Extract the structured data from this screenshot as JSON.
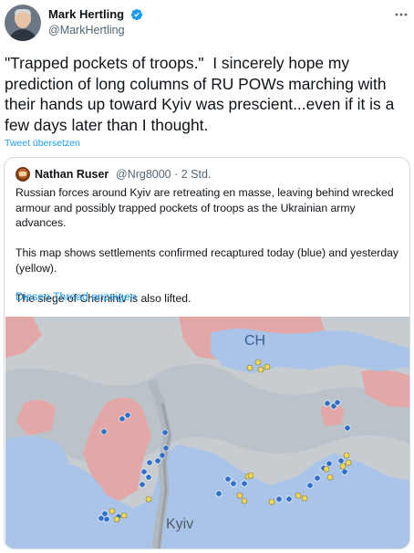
{
  "author": {
    "display_name": "Mark Hertling",
    "handle": "@MarkHertling",
    "verified": true
  },
  "tweet": {
    "text": "\"Trapped pockets of troops.\"  I sincerely hope my prediction of long columns of RU POWs marching with their hands up toward Kyiv was prescient...even if it is a few days later than I thought.",
    "translate_label": "Tweet übersetzen"
  },
  "quoted_tweet": {
    "display_name": "Nathan Ruser",
    "meta": "@Nrg8000 · 2 Std.",
    "paragraphs": [
      "Russian forces around Kyiv are retreating en masse, leaving behind wrecked armour and possibly trapped pockets of troops as the Ukrainian army advances.",
      "This map shows settlements confirmed recaptured today (blue) and yesterday (yellow).",
      "The siege of Chernihiv is also lifted."
    ],
    "thread_link": "Diesen Thread anzeigen"
  },
  "map": {
    "labels": {
      "chernihiv": "CH",
      "kyiv": "Kyiv"
    },
    "colors": {
      "background": "#c7ccd0",
      "russian_area": "#e3a7a8",
      "ukrainian_area": "#a9c4e8",
      "blue_dot": "#2f6fc6",
      "yellow_dot": "#f0d85a"
    }
  },
  "colors": {
    "accent": "#1d9bf0",
    "text": "#0f1419",
    "secondary": "#536471",
    "border": "#cfd9de"
  }
}
